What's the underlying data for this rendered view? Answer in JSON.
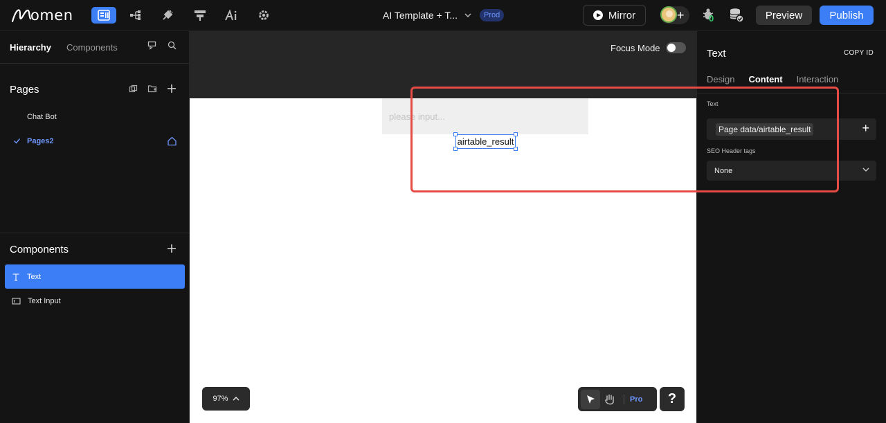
{
  "app": {
    "logo_text": "omen",
    "project_title": "AI Template + T...",
    "env_badge": "Prod",
    "mirror_label": "Mirror",
    "bug_count": "0",
    "preview_label": "Preview",
    "publish_label": "Publish",
    "nav_icons": [
      "page-editor-icon",
      "flow-icon",
      "plugin-icon",
      "layout-icon",
      "ai-icon",
      "settings-icon"
    ]
  },
  "left": {
    "tabs": [
      "Hierarchy",
      "Components"
    ],
    "pages_title": "Pages",
    "pages": [
      {
        "label": "Chat Bot",
        "active": false
      },
      {
        "label": "Pages2",
        "active": true
      }
    ],
    "components_title": "Components",
    "components": [
      {
        "label": "Text",
        "active": true
      },
      {
        "label": "Text Input",
        "active": false
      }
    ]
  },
  "canvas": {
    "focus_mode_label": "Focus Mode",
    "focus_mode_on": false,
    "input_placeholder": "please input...",
    "selected_text": "airtable_result",
    "zoom": "97%",
    "pro_label": "Pro",
    "help_label": "?"
  },
  "right": {
    "title": "Text",
    "copy_id_label": "COPY ID",
    "tabs": [
      "Design",
      "Content",
      "Interaction"
    ],
    "active_tab": "Content",
    "text_label": "Text",
    "text_binding": "Page data/airtable_result",
    "seo_label": "SEO Header tags",
    "seo_value": "None"
  },
  "colors": {
    "accent": "#3b7ef6",
    "highlight": "#e64b45",
    "badge_text": "#6f97ff",
    "bug_count": "#35c46a"
  }
}
